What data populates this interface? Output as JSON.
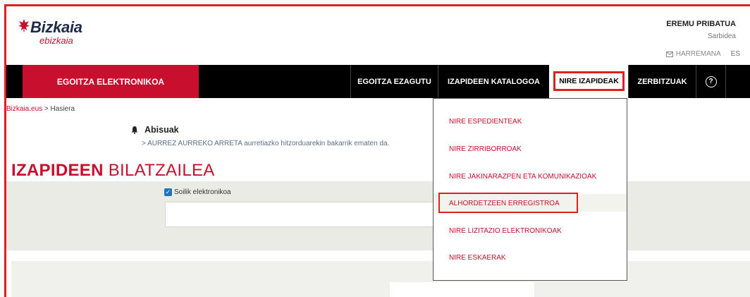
{
  "brand": {
    "name": "Bizkaia",
    "sub": "ebizkaia",
    "primary_color": "#c8102e",
    "highlight_color": "#e02020"
  },
  "header": {
    "eremu": "EREMU PRIBATUA",
    "sarbidea": "Sarbidea",
    "harremana": "HARREMANA",
    "language": "ES",
    "mail_icon": "envelope-icon"
  },
  "nav": {
    "egoitza": "EGOITZA ELEKTRONIKOA",
    "ezagutu": "EGOITZA EZAGUTU",
    "katalogoa": "IZAPIDEEN KATALOGOA",
    "nire_izapideak": "NIRE IZAPIDEAK",
    "zerbitzuak": "ZERBITZUAK",
    "help_symbol": "?"
  },
  "breadcrumb": {
    "link": "Bizkaia.eus",
    "separator": " > ",
    "current": "Hasiera"
  },
  "alerts": {
    "title": "Abisuak",
    "message": "> AURREZ AURREKO ARRETA aurretiazko hitzorduarekin bakarrik ematen da."
  },
  "search": {
    "title_bold": "IZAPIDEEN",
    "title_thin": "BILATZAILEA",
    "checkbox_label": "Soilik elektronikoa",
    "checkbox_checked": true,
    "input_value": ""
  },
  "dropdown": {
    "items": [
      "NIRE ESPEDIENTEAK",
      "NIRE ZIRRIBORROAK",
      "NIRE JAKINARAZPEN ETA KOMUNIKAZIOAK",
      "ALHORDETZEEN ERREGISTROA",
      "NIRE LIZITAZIO ELEKTRONIKOAK",
      "NIRE ESKAERAK"
    ],
    "highlighted_index": 3
  }
}
